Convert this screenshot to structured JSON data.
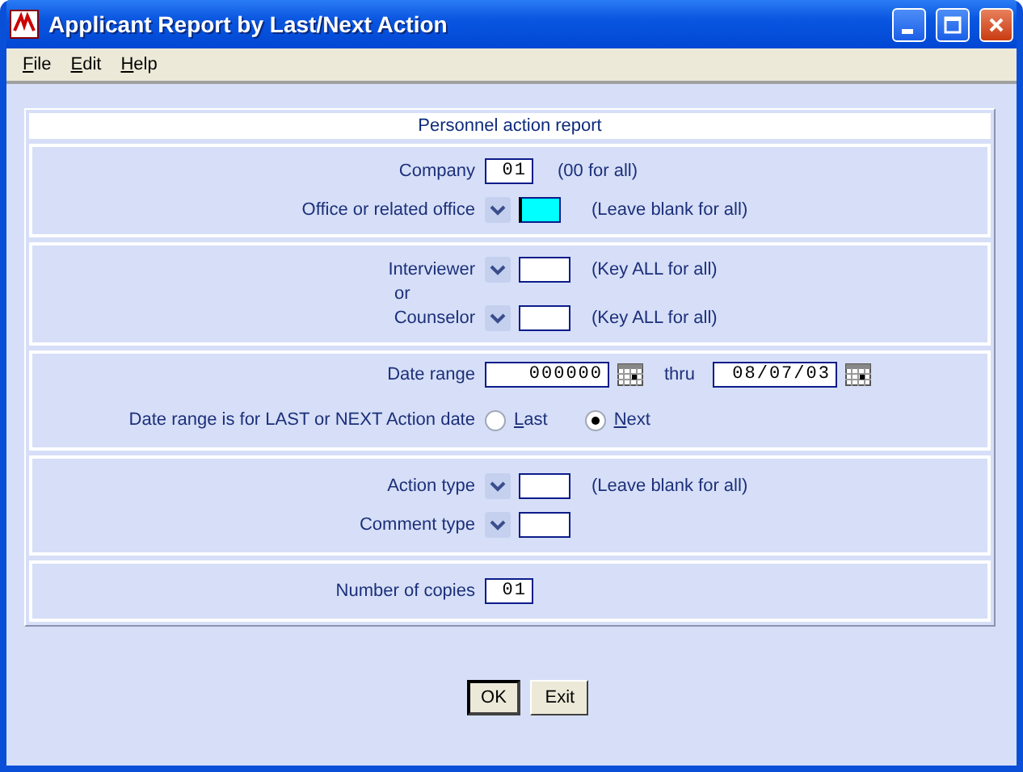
{
  "window": {
    "title": "Applicant Report by Last/Next Action"
  },
  "menu": [
    {
      "label": "File"
    },
    {
      "label": "Edit"
    },
    {
      "label": "Help"
    }
  ],
  "report": {
    "title": "Personnel action report",
    "sections": [
      {
        "rows": [
          {
            "kind": "field",
            "label": "Company",
            "value": "01",
            "hint": "(00 for all)"
          },
          {
            "kind": "lookup",
            "label": "Office or related office",
            "value": "",
            "focused": true,
            "hint": "(Leave blank for all)"
          }
        ]
      },
      {
        "rows": [
          {
            "kind": "lookup",
            "label": "Interviewer",
            "value": "",
            "focused": false,
            "hint": "(Key ALL for all)"
          },
          {
            "kind": "text",
            "label": "or"
          },
          {
            "kind": "lookup",
            "label": "Counselor",
            "value": "",
            "focused": false,
            "hint": "(Key ALL for all)"
          }
        ]
      },
      {
        "rows": [
          {
            "kind": "daterange",
            "label": "Date range",
            "from": "000000",
            "joiner": "thru",
            "to": "08/07/03"
          },
          {
            "kind": "radio",
            "label": "Date range is for LAST or NEXT Action date",
            "options": [
              {
                "label": "Last",
                "selected": false
              },
              {
                "label": "Next",
                "selected": true
              }
            ]
          }
        ]
      },
      {
        "rows": [
          {
            "kind": "lookup",
            "label": "Action type",
            "value": "",
            "focused": false,
            "hint": "(Leave blank for all)"
          },
          {
            "kind": "lookup",
            "label": "Comment type",
            "value": "",
            "focused": false
          }
        ]
      },
      {
        "rows": [
          {
            "kind": "field",
            "label": "Number of copies",
            "value": "01"
          }
        ]
      }
    ]
  },
  "buttons": [
    {
      "label": "OK",
      "default": true
    },
    {
      "label": "Exit",
      "default": false
    }
  ]
}
